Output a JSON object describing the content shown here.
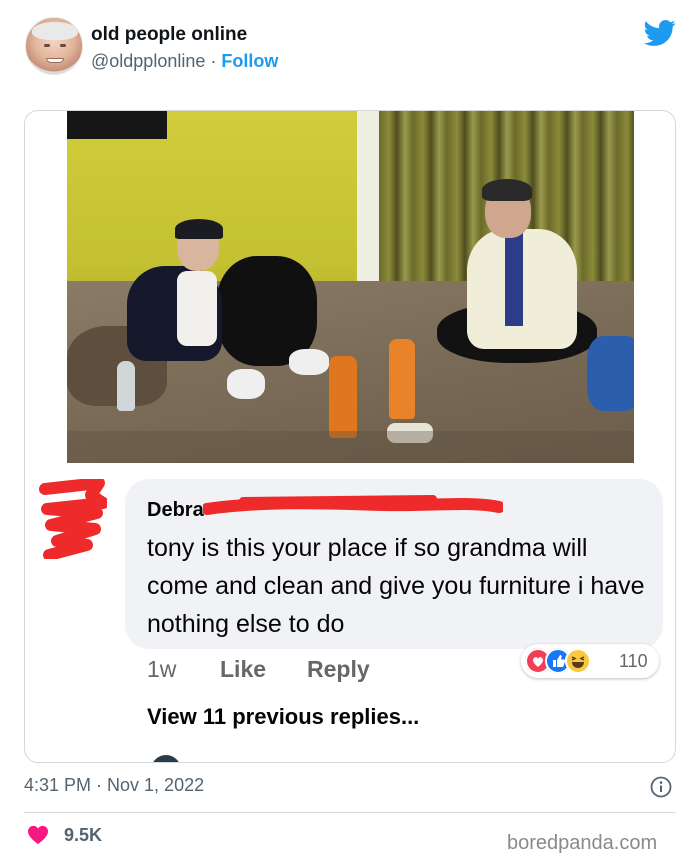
{
  "tweet": {
    "author_name": "old people online",
    "author_handle": "@oldpplonline",
    "separator": "·",
    "follow_label": "Follow",
    "timestamp": "4:31 PM · Nov 1, 2022",
    "likes_count": "9.5K",
    "brand_color": "#1d9bf0"
  },
  "facebook_comment": {
    "commenter_first_name": "Debra",
    "text": "tony is this your place if so grandma will come and clean and give you furniture i have nothing else to do",
    "age": "1w",
    "like_label": "Like",
    "reply_label": "Reply",
    "reaction_count": "110",
    "reactions": [
      "love",
      "like",
      "haha"
    ],
    "view_replies_label": "View 11 previous replies..."
  },
  "watermark": "boredpanda.com",
  "icons": [
    "twitter-bird-icon",
    "info-icon",
    "heart-icon",
    "love-reaction-icon",
    "like-reaction-icon",
    "haha-reaction-icon"
  ]
}
